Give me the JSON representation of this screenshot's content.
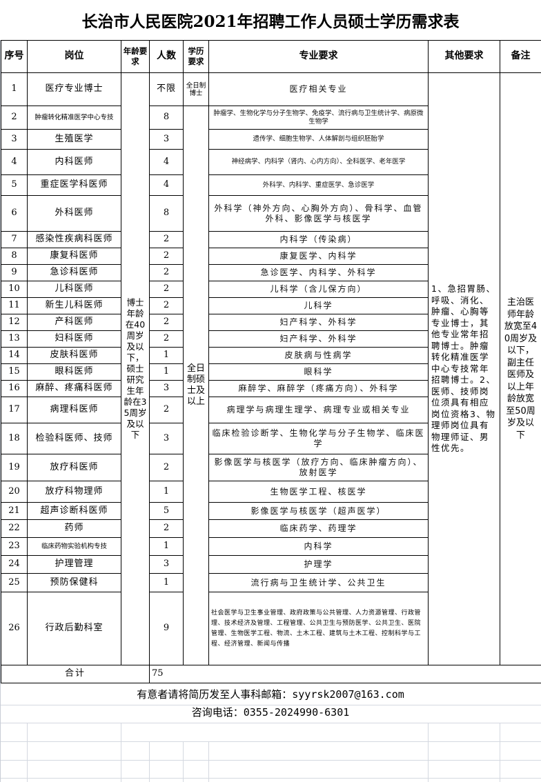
{
  "title": "长治市人民医院2021年招聘工作人员硕士学历需求表",
  "headers": {
    "seq": "序号",
    "position": "岗位",
    "age": "年龄要求",
    "count": "人数",
    "education": "学历要求",
    "major": "专业要求",
    "other": "其他要求",
    "remark": "备注"
  },
  "rows": [
    {
      "seq": "1",
      "position": "医疗专业博士",
      "count": "不限",
      "major": "医疗相关专业"
    },
    {
      "seq": "2",
      "position": "肿瘤转化精准医学中心专技",
      "count": "8",
      "major": "肿瘤学、生物化学与分子生物学、免疫学、流行病与卫生统计学、病原微生物学"
    },
    {
      "seq": "3",
      "position": "生殖医学",
      "count": "3",
      "major": "遗传学、细胞生物学、人体解剖与组织胚胎学"
    },
    {
      "seq": "4",
      "position": "内科医师",
      "count": "4",
      "major": "神经病学、内科学（肾内、心内方向）、全科医学、老年医学"
    },
    {
      "seq": "5",
      "position": "重症医学科医师",
      "count": "4",
      "major": "外科学、内科学、重症医学、急诊医学"
    },
    {
      "seq": "6",
      "position": "外科医师",
      "count": "8",
      "major": "外科学（神外方向、心胸外方向）、骨科学、血管外科、影像医学与核医学"
    },
    {
      "seq": "7",
      "position": "感染性疾病科医师",
      "count": "2",
      "major": "内科学（传染病）"
    },
    {
      "seq": "8",
      "position": "康复科医师",
      "count": "2",
      "major": "康复医学、内科学"
    },
    {
      "seq": "9",
      "position": "急诊科医师",
      "count": "2",
      "major": "急诊医学、内科学、外科学"
    },
    {
      "seq": "10",
      "position": "儿科医师",
      "count": "2",
      "major": "儿科学（含儿保方向）"
    },
    {
      "seq": "11",
      "position": "新生儿科医师",
      "count": "2",
      "major": "儿科学"
    },
    {
      "seq": "12",
      "position": "产科医师",
      "count": "2",
      "major": "妇产科学、外科学"
    },
    {
      "seq": "13",
      "position": "妇科医师",
      "count": "2",
      "major": "妇产科学、外科学"
    },
    {
      "seq": "14",
      "position": "皮肤科医师",
      "count": "1",
      "major": "皮肤病与性病学"
    },
    {
      "seq": "15",
      "position": "眼科医师",
      "count": "1",
      "major": "眼科学"
    },
    {
      "seq": "16",
      "position": "麻醉、疼痛科医师",
      "count": "3",
      "major": "麻醉学、麻醉学（疼痛方向）、外科学"
    },
    {
      "seq": "17",
      "position": "病理科医师",
      "count": "2",
      "major": "病理学与病理生理学、病理专业或相关专业"
    },
    {
      "seq": "18",
      "position": "检验科医师、技师",
      "count": "3",
      "major": "临床检验诊断学、生物化学与分子生物学、临床医学"
    },
    {
      "seq": "19",
      "position": "放疗科医师",
      "count": "2",
      "major": "影像医学与核医学（放疗方向、临床肿瘤方向）、放射医学"
    },
    {
      "seq": "20",
      "position": "放疗科物理师",
      "count": "1",
      "major": "生物医学工程、核医学"
    },
    {
      "seq": "21",
      "position": "超声诊断科医师",
      "count": "5",
      "major": "影像医学与核医学（超声医学）"
    },
    {
      "seq": "22",
      "position": "药师",
      "count": "2",
      "major": "临床药学、药理学"
    },
    {
      "seq": "23",
      "position": "临床药物实验机构专技",
      "count": "1",
      "major": "内科学"
    },
    {
      "seq": "24",
      "position": "护理管理",
      "count": "3",
      "major": "护理学"
    },
    {
      "seq": "25",
      "position": "预防保健科",
      "count": "1",
      "major": "流行病与卫生统计学、公共卫生"
    },
    {
      "seq": "26",
      "position": "行政后勤科室",
      "count": "9",
      "major": "社会医学与卫生事业管理、政府政策与公共管理、人力资源管理、行政管理、技术经济及管理、工程管理、公共卫生与预防医学、公共卫生、医院管理、生物医学工程、物流、土木工程、建筑与土木工程、控制科学与工程、经济管理、新闻与传播"
    }
  ],
  "merged": {
    "age_requirement": "博士年龄在40周岁及以下，硕士研究生年龄在35周岁及以下",
    "education_row1": "全日制博士",
    "education_rest": "全日制硕士及以上",
    "other_requirements": "1、急招胃肠、呼吸、消化、肿瘤、心胸等专业博士，其他专业常年招聘博士。肿瘤转化精准医学中心专技常年招聘博士。2、医师、技师岗位须具有相应岗位资格3、物理师岗位具有物理师证、男性优先。",
    "remark": "主治医师年龄放宽至40周岁及以下，副主任医师及以上年龄放宽至50周岁及以下"
  },
  "total": {
    "label": "合计",
    "value": "75"
  },
  "footer": {
    "email_line": "有意者请将简历发至人事科邮箱：syyrsk2007@163.com",
    "phone_line": "咨询电话：0355-2024990-6301"
  }
}
